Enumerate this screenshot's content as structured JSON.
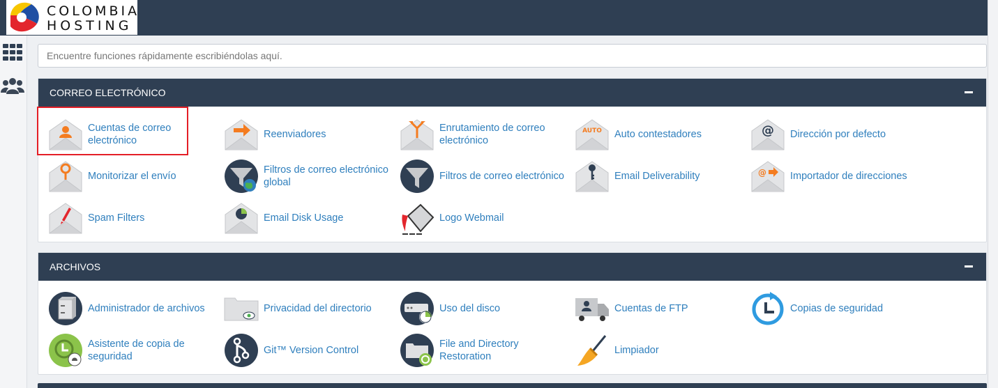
{
  "brand": {
    "line1": "COLOMBIA",
    "line2": "HOSTING"
  },
  "search": {
    "placeholder": "Encuentre funciones rápidamente escribiéndolas aquí."
  },
  "sidebar": {
    "items": [
      {
        "icon": "grid-icon"
      },
      {
        "icon": "users-icon"
      }
    ]
  },
  "email_section": {
    "title": "CORREO ELECTRÓNICO",
    "items": [
      {
        "label": "Cuentas de correo electrónico",
        "icon": "email-accounts-icon"
      },
      {
        "label": "Reenviadores",
        "icon": "forwarders-icon"
      },
      {
        "label": "Enrutamiento de correo electrónico",
        "icon": "email-routing-icon"
      },
      {
        "label": "Auto contestadores",
        "icon": "autoresponders-icon"
      },
      {
        "label": "Dirección por defecto",
        "icon": "default-address-icon"
      },
      {
        "label": "Monitorizar el envío",
        "icon": "track-delivery-icon"
      },
      {
        "label": "Filtros de correo electrónico global",
        "icon": "global-filters-icon"
      },
      {
        "label": "Filtros de correo electrónico",
        "icon": "email-filters-icon"
      },
      {
        "label": "Email Deliverability",
        "icon": "deliverability-icon"
      },
      {
        "label": "Importador de direcciones",
        "icon": "address-importer-icon"
      },
      {
        "label": "Spam Filters",
        "icon": "spam-filters-icon"
      },
      {
        "label": "Email Disk Usage",
        "icon": "email-disk-usage-icon"
      },
      {
        "label": "Logo Webmail",
        "icon": "webmail-logo-icon"
      }
    ]
  },
  "files_section": {
    "title": "ARCHIVOS",
    "items": [
      {
        "label": "Administrador de archivos",
        "icon": "file-manager-icon"
      },
      {
        "label": "Privacidad del directorio",
        "icon": "directory-privacy-icon"
      },
      {
        "label": "Uso del disco",
        "icon": "disk-usage-icon"
      },
      {
        "label": "Cuentas de FTP",
        "icon": "ftp-accounts-icon"
      },
      {
        "label": "Copias de seguridad",
        "icon": "backup-icon"
      },
      {
        "label": "Asistente de copia de seguridad",
        "icon": "backup-wizard-icon"
      },
      {
        "label": "Git™ Version Control",
        "icon": "git-icon"
      },
      {
        "label": "File and Directory Restoration",
        "icon": "restoration-icon"
      },
      {
        "label": "Limpiador",
        "icon": "cleaner-icon"
      }
    ]
  },
  "colors": {
    "header": "#2f3f53",
    "link": "#2f7fbd",
    "accent_orange": "#f47c20",
    "highlight": "#e41e26"
  }
}
